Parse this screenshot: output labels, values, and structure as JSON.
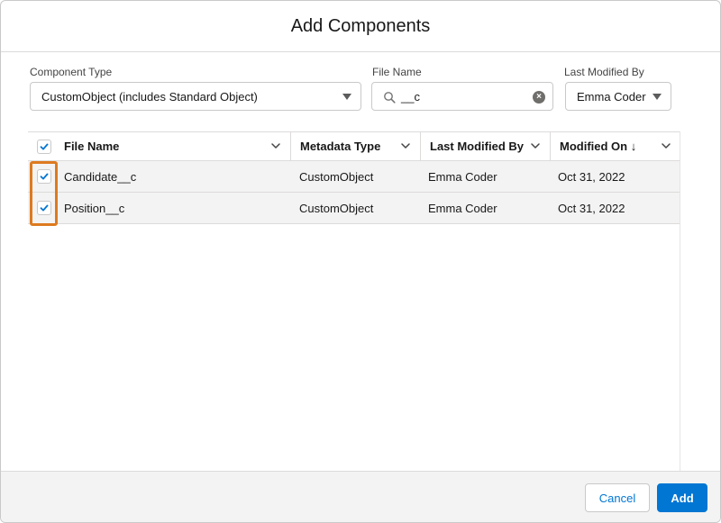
{
  "modal": {
    "title": "Add Components"
  },
  "filters": {
    "component_type": {
      "label": "Component Type",
      "value": "CustomObject (includes Standard Object)"
    },
    "file_name": {
      "label": "File Name",
      "value": "__c"
    },
    "last_modified_by": {
      "label": "Last Modified By",
      "value": "Emma Coder"
    }
  },
  "table": {
    "columns": [
      "File Name",
      "Metadata Type",
      "Last Modified By",
      "Modified On ↓"
    ],
    "rows": [
      {
        "file_name": "Candidate__c",
        "metadata_type": "CustomObject",
        "last_modified_by": "Emma Coder",
        "modified_on": "Oct 31, 2022",
        "checked": true
      },
      {
        "file_name": "Position__c",
        "metadata_type": "CustomObject",
        "last_modified_by": "Emma Coder",
        "modified_on": "Oct 31, 2022",
        "checked": true
      }
    ]
  },
  "footer": {
    "cancel_label": "Cancel",
    "add_label": "Add"
  },
  "colors": {
    "brand": "#0176d3",
    "highlight": "#dd7a1f"
  }
}
